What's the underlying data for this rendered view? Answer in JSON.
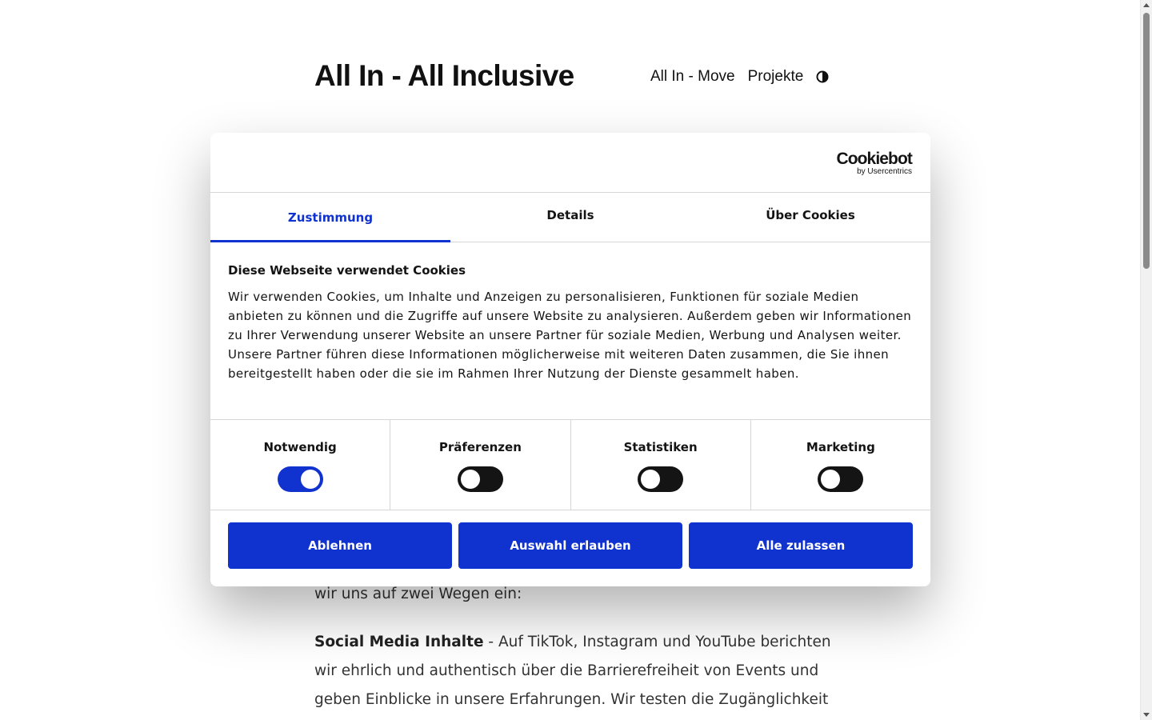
{
  "site": {
    "title": "All In - All Inclusive",
    "nav": [
      "All In - Move",
      "Projekte"
    ],
    "theme_toggle_icon": "half-circle-contrast-icon"
  },
  "content": {
    "line_tail": "wir uns auf zwei Wegen ein:",
    "para_bold": "Social Media Inhalte",
    "para_text": " - Auf TikTok, Instagram und YouTube berichten wir ehrlich und authentisch über die Barrierefreiheit von Events und geben Einblicke in unsere Erfahrungen. Wir testen die Zugänglichkeit"
  },
  "cookie": {
    "brand": {
      "name": "Cookiebot",
      "sub": "by Usercentrics"
    },
    "tabs": [
      "Zustimmung",
      "Details",
      "Über Cookies"
    ],
    "active_tab": "Zustimmung",
    "heading": "Diese Webseite verwendet Cookies",
    "text": "Wir verwenden Cookies, um Inhalte und Anzeigen zu personalisieren, Funktionen für soziale Medien anbieten zu können und die Zugriffe auf unsere Website zu analysieren. Außerdem geben wir Informationen zu Ihrer Verwendung unserer Website an unsere Partner für soziale Medien, Werbung und Analysen weiter. Unsere Partner führen diese Informationen möglicherweise mit weiteren Daten zusammen, die Sie ihnen bereitgestellt haben oder die sie im Rahmen Ihrer Nutzung der Dienste gesammelt haben.",
    "categories": [
      {
        "label": "Notwendig",
        "enabled": true
      },
      {
        "label": "Präferenzen",
        "enabled": false
      },
      {
        "label": "Statistiken",
        "enabled": false
      },
      {
        "label": "Marketing",
        "enabled": false
      }
    ],
    "buttons": {
      "deny": "Ablehnen",
      "allow_selection": "Auswahl erlauben",
      "allow_all": "Alle zulassen"
    }
  },
  "colors": {
    "accent": "#1032cf",
    "toggle_off": "#141414",
    "text": "#141414"
  }
}
